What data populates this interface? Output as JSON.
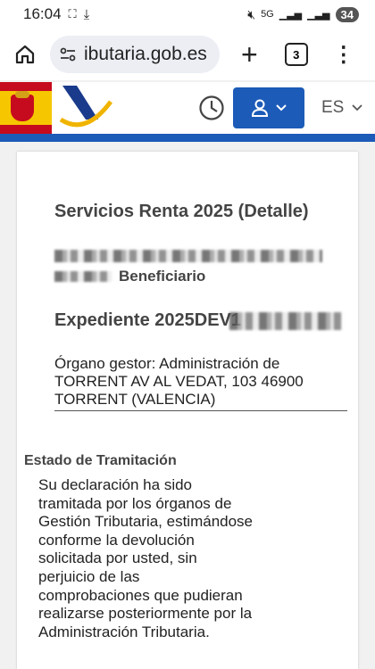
{
  "status_bar": {
    "time": "16:04",
    "network": "5G",
    "battery": "34"
  },
  "browser": {
    "url": "ibutaria.gob.es",
    "tab_count": "3"
  },
  "site": {
    "language": "ES"
  },
  "detail": {
    "title": "Servicios Renta 2025 (Detalle)",
    "role": "Beneficiario",
    "expediente": "Expediente 2025DEV1",
    "organo_gestor": "Órgano gestor: Administración de TORRENT  AV AL VEDAT, 103 46900 TORRENT (VALENCIA)"
  },
  "estado": {
    "heading": "Estado de Tramitación",
    "text": "Su declaración ha sido tramitada por los órganos de Gestión Tributaria, estimándose conforme la devolución solicitada por usted, sin perjuicio de las comprobaciones que pudieran realizarse posteriormente por la Administración Tributaria."
  }
}
